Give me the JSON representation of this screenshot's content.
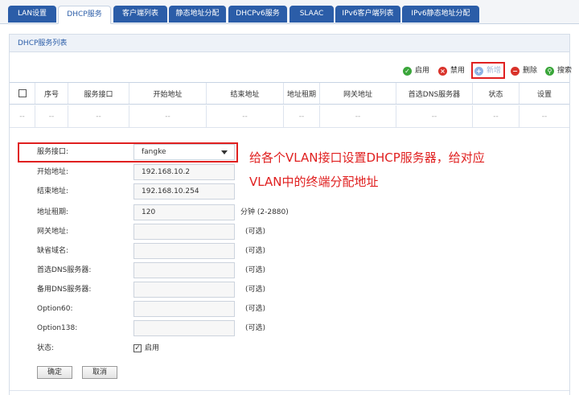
{
  "tabs": [
    {
      "label": "LAN设置",
      "active": false
    },
    {
      "label": "DHCP服务",
      "active": true
    },
    {
      "label": "客户端列表",
      "active": false
    },
    {
      "label": "静态地址分配",
      "active": false
    },
    {
      "label": "DHCPv6服务",
      "active": false
    },
    {
      "label": "SLAAC",
      "active": false
    },
    {
      "label": "IPv6客户端列表",
      "active": false
    },
    {
      "label": "IPv6静态地址分配",
      "active": false
    }
  ],
  "section_title": "DHCP服务列表",
  "toolbar": {
    "enable": "启用",
    "disable": "禁用",
    "add": "新增",
    "delete": "删除",
    "search": "搜索"
  },
  "table": {
    "headers": [
      "序号",
      "服务接口",
      "开始地址",
      "结束地址",
      "地址租期",
      "网关地址",
      "首选DNS服务器",
      "状态",
      "设置"
    ],
    "empty_row": [
      "--",
      "--",
      "--",
      "--",
      "--",
      "--",
      "--",
      "--",
      "--",
      "--"
    ]
  },
  "form": {
    "interface_label": "服务接口:",
    "interface_value": "fangke",
    "start_label": "开始地址:",
    "start_value": "192.168.10.2",
    "end_label": "结束地址:",
    "end_value": "192.168.10.254",
    "lease_label": "地址租期:",
    "lease_value": "120",
    "lease_hint": "分钟 (2-2880)",
    "gateway_label": "网关地址:",
    "domain_label": "缺省域名:",
    "dns1_label": "首选DNS服务器:",
    "dns2_label": "备用DNS服务器:",
    "opt60_label": "Option60:",
    "opt138_label": "Option138:",
    "status_label": "状态:",
    "status_enable": "启用",
    "optional_hint": "(可选)",
    "ok_button": "确定",
    "cancel_button": "取消"
  },
  "annotation": {
    "line1": "给各个VLAN接口设置DHCP服务器，给对应",
    "line2": "VLAN中的终端分配地址"
  },
  "colors": {
    "tab_bg": "#2b5da8",
    "accent": "#2b5da8",
    "highlight": "#e02020",
    "enable_icon": "#3aa63a",
    "disable_icon": "#d9332b",
    "add_icon": "#8fb3e3",
    "search_icon": "#3aa63a"
  }
}
